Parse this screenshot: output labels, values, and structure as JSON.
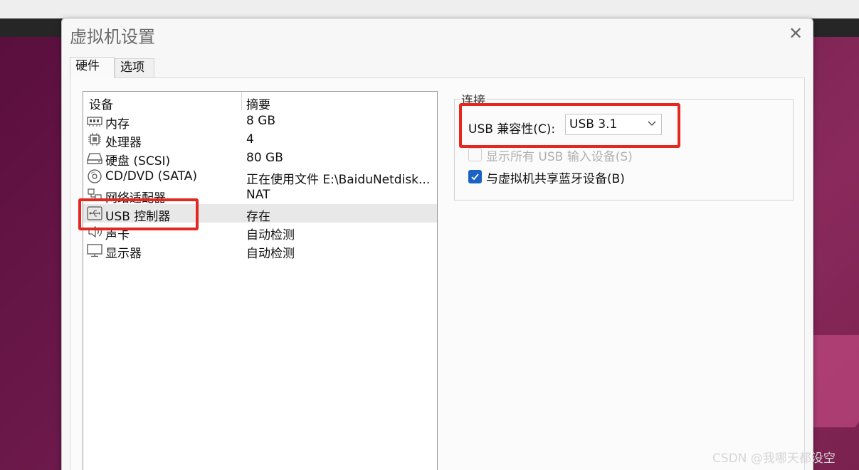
{
  "window": {
    "title": "虚拟机设置",
    "close_glyph": "✕"
  },
  "tabs": [
    {
      "label": "硬件",
      "active": true
    },
    {
      "label": "选项",
      "active": false
    }
  ],
  "device_list": {
    "headers": {
      "device": "设备",
      "summary": "摘要"
    },
    "rows": [
      {
        "icon": "memory-icon",
        "name": "内存",
        "summary": "8 GB"
      },
      {
        "icon": "processor-icon",
        "name": "处理器",
        "summary": "4"
      },
      {
        "icon": "harddisk-icon",
        "name": "硬盘 (SCSI)",
        "summary": "80 GB"
      },
      {
        "icon": "cd-dvd-icon",
        "name": "CD/DVD (SATA)",
        "summary": "正在使用文件 E:\\BaiduNetdisk..."
      },
      {
        "icon": "network-adapter-icon",
        "name": "网络适配器",
        "summary": "NAT"
      },
      {
        "icon": "usb-icon",
        "name": "USB 控制器",
        "summary": "存在",
        "selected": true
      },
      {
        "icon": "sound-card-icon",
        "name": "声卡",
        "summary": "自动检测"
      },
      {
        "icon": "display-icon",
        "name": "显示器",
        "summary": "自动检测"
      }
    ]
  },
  "connection": {
    "group_label": "连接",
    "usb_compat_label": "USB 兼容性(C):",
    "usb_compat_value": "USB 3.1",
    "show_all_usb_label": "显示所有 USB 输入设备(S)",
    "show_all_usb_checked": false,
    "share_bluetooth_label": "与虚拟机共享蓝牙设备(B)",
    "share_bluetooth_checked": true
  },
  "annotations": {
    "highlight_color": "#e5271f"
  },
  "watermark": "CSDN @我哪天都没空",
  "colors": {
    "accent": "#1a62c4",
    "selected_row": "#e8e8e8"
  }
}
